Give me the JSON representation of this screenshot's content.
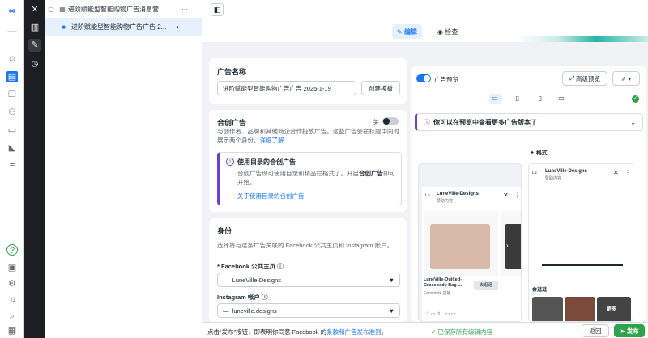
{
  "tree": {
    "campaign_name": "进阶赋能型智能购物广告消息营...",
    "ad_name": "进阶赋能型智能购物广告广告 2..."
  },
  "topbar": {
    "edit_label": "编辑",
    "check_label": "检查"
  },
  "ad_name_section": {
    "title": "广告名称",
    "value": "进阶赋能型智能购物广告广告 2025-1-19",
    "create_template": "创建模板"
  },
  "partnership": {
    "title": "合创广告",
    "toggle_label": "关",
    "description": "与创作者、品牌和其他商企合作投放广告。这些广告会在标题中同时展示两个身份。",
    "details_link": "详细了解",
    "info_title": "使用目录的合创广告",
    "info_body_1": "合创广告现可使用目录和精品栏格式了。开启",
    "info_body_bold": "合创广告",
    "info_body_2": "即可开始。",
    "info_link": "关于使用目录的合创广告"
  },
  "identity": {
    "title": "身份",
    "description": "选择将与这条广告关联的 Facebook 公共主页和 Instagram 账户。",
    "fb_label": "* Facebook 公共主页",
    "fb_value": "LuneVille-Designs",
    "ig_label": "Instagram 帐户",
    "ig_value": "luneville.designs"
  },
  "preview": {
    "toggle_label": "广告预览",
    "advanced_label": "高级预览",
    "banner_text": "你可以在预览中查看更多广告版本了",
    "format_tag": "格式",
    "brand": "LuneVille-Designs",
    "sponsored": "赞助内容",
    "product_title": "LuneVille-Quilted-Crossbody Bag-...",
    "product_sub": "Facebook 店铺",
    "cta": "去逛逛",
    "section_label": "会逛逛",
    "more": "更多"
  },
  "footer": {
    "text_prefix": "点击“发布”按钮，即表明你同意 Facebook 的",
    "terms_link": "条款和广告发布准则",
    "text_suffix": "。",
    "saved": "已保存所有编辑内容",
    "back": "返回",
    "publish": "发布"
  }
}
